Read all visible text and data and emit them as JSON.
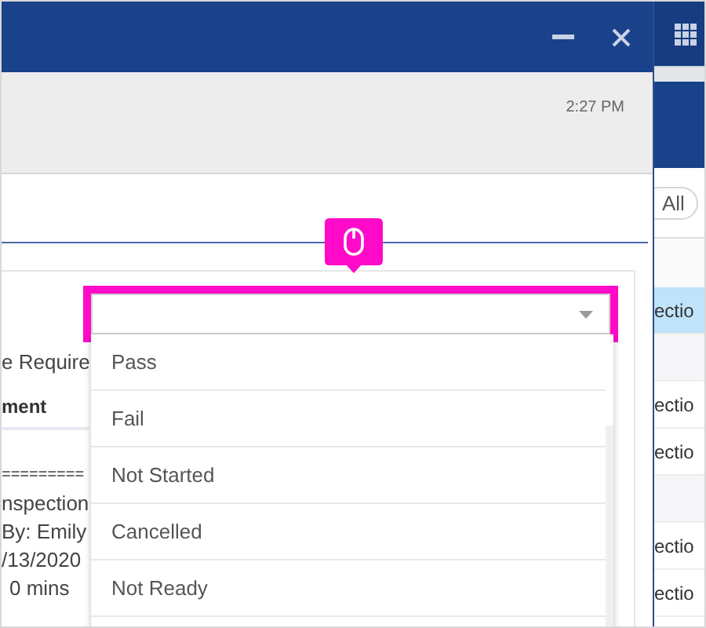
{
  "dialog": {
    "time": "2:27 PM",
    "label": "e Require",
    "heading": "ment",
    "notes": [
      {
        "text": "=========",
        "indent": false
      },
      {
        "text": "nspection",
        "indent": false
      },
      {
        "text": "By: Emily",
        "indent": false
      },
      {
        "text": "/13/2020",
        "indent": false
      },
      {
        "text": "0 mins",
        "indent": true
      }
    ]
  },
  "dropdown": {
    "options": [
      {
        "label": "Pass",
        "selected": false
      },
      {
        "label": "Fail",
        "selected": false
      },
      {
        "label": "Not Started",
        "selected": false
      },
      {
        "label": "Cancelled",
        "selected": false
      },
      {
        "label": "Not Ready",
        "selected": false
      }
    ]
  },
  "side": {
    "filter": "All",
    "rows": [
      {
        "kind": "entry",
        "text": "ectio",
        "selected": true
      },
      {
        "kind": "gap"
      },
      {
        "kind": "entry",
        "text": "ectio",
        "selected": false
      },
      {
        "kind": "entry",
        "text": "ectio",
        "selected": false
      },
      {
        "kind": "gap"
      },
      {
        "kind": "entry",
        "text": "ectio",
        "selected": false
      },
      {
        "kind": "entry",
        "text": "ectio",
        "selected": false
      }
    ]
  }
}
